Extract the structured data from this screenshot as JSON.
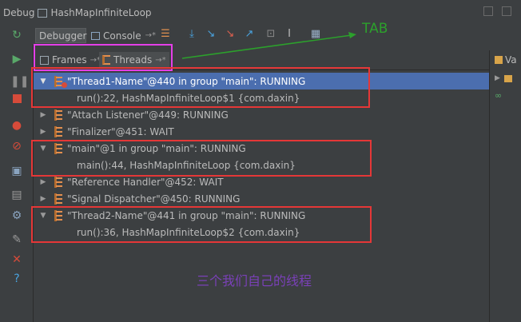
{
  "title_bar": {
    "title": "Debug",
    "tab": "HashMapInfiniteLoop"
  },
  "toolbar": {
    "debugger_tab": "Debugger",
    "console_tab": "Console"
  },
  "subtabs": {
    "frames": "Frames",
    "threads": "Threads",
    "pin": "→*"
  },
  "right_panel": {
    "label": "Va"
  },
  "threads": [
    {
      "name": "\"Thread1-Name\"@440 in group \"main\": RUNNING",
      "expanded": true,
      "selected": true,
      "frame": "run():22, HashMapInfiniteLoop$1 {com.daxin}"
    },
    {
      "name": "\"Attach Listener\"@449: RUNNING",
      "expanded": false
    },
    {
      "name": "\"Finalizer\"@451: WAIT",
      "expanded": false
    },
    {
      "name": "\"main\"@1 in group \"main\": RUNNING",
      "expanded": true,
      "frame": "main():44, HashMapInfiniteLoop {com.daxin}"
    },
    {
      "name": "\"Reference Handler\"@452: WAIT",
      "expanded": false
    },
    {
      "name": "\"Signal Dispatcher\"@450: RUNNING",
      "expanded": false
    },
    {
      "name": "\"Thread2-Name\"@441 in group \"main\": RUNNING",
      "expanded": true,
      "frame": "run():36, HashMapInfiniteLoop$2 {com.daxin}"
    }
  ],
  "annotations": {
    "tab_label": "TAB",
    "note": "三个我们自己的线程"
  },
  "colors": {
    "selection": "#4b6eaf",
    "annotation_red": "#e53737",
    "annotation_pink": "#e43fe8",
    "annotation_green": "#2ca02c",
    "note_purple": "#7a40b8"
  }
}
